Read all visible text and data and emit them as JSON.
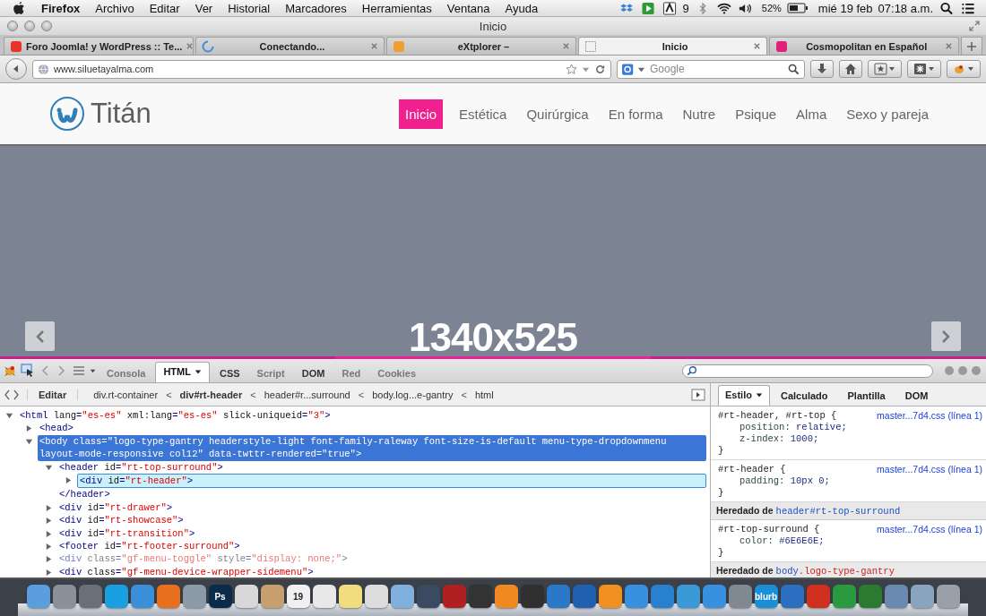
{
  "menubar": {
    "app": "Firefox",
    "items": [
      "Archivo",
      "Editar",
      "Ver",
      "Historial",
      "Marcadores",
      "Herramientas",
      "Ventana",
      "Ayuda"
    ],
    "status": {
      "adobe_count": "9",
      "battery": "52%",
      "date": "mié 19 feb",
      "time": "07:18 a.m."
    }
  },
  "window": {
    "title": "Inicio"
  },
  "tabs": [
    {
      "label": "Foro Joomla! y WordPress :: Te...",
      "selected": false,
      "kind": "site",
      "color": "#e8332b"
    },
    {
      "label": "Conectando...",
      "selected": false,
      "kind": "loading",
      "color": "#3b8de0"
    },
    {
      "label": "eXtplorer –",
      "selected": false,
      "kind": "site",
      "color": "#f0a030"
    },
    {
      "label": "Inicio",
      "selected": true,
      "kind": "blank"
    },
    {
      "label": "Cosmopolitan en Español",
      "selected": false,
      "kind": "site",
      "color": "#e0227a"
    }
  ],
  "navbar": {
    "url": "www.siluetayalma.com",
    "search_placeholder": "Google"
  },
  "site": {
    "logo": "Titán",
    "nav": [
      {
        "label": "Inicio",
        "selected": true
      },
      {
        "label": "Estética",
        "selected": false
      },
      {
        "label": "Quirúrgica",
        "selected": false
      },
      {
        "label": "En forma",
        "selected": false
      },
      {
        "label": "Nutre",
        "selected": false
      },
      {
        "label": "Psique",
        "selected": false
      },
      {
        "label": "Alma",
        "selected": false
      },
      {
        "label": "Sexo y pareja",
        "selected": false
      }
    ]
  },
  "slide": {
    "label": "1340x525"
  },
  "devtools": {
    "tabs": [
      {
        "label": "Consola",
        "selected": false,
        "disabled": true,
        "menu": false
      },
      {
        "label": "HTML",
        "selected": true,
        "disabled": false,
        "menu": true
      },
      {
        "label": "CSS",
        "selected": false,
        "disabled": false,
        "menu": false
      },
      {
        "label": "Script",
        "selected": false,
        "disabled": true,
        "menu": false
      },
      {
        "label": "DOM",
        "selected": false,
        "disabled": false,
        "menu": false
      },
      {
        "label": "Red",
        "selected": false,
        "disabled": true,
        "menu": false
      },
      {
        "label": "Cookies",
        "selected": false,
        "disabled": true,
        "menu": false
      }
    ],
    "edit": "Editar",
    "breadcrumb": [
      {
        "label": "div.rt-container",
        "selected": false
      },
      {
        "label": "div#rt-header",
        "selected": true,
        "separator": "<"
      },
      {
        "label": "header#r...surround",
        "selected": false,
        "separator": "<"
      },
      {
        "label": "body.log...e-gantry",
        "selected": false,
        "separator": "<"
      },
      {
        "label": "html",
        "selected": false,
        "separator": "<"
      }
    ],
    "side_tabs": [
      {
        "label": "Estilo",
        "selected": true,
        "menu": true
      },
      {
        "label": "Calculado",
        "selected": false,
        "menu": false
      },
      {
        "label": "Plantilla",
        "selected": false,
        "menu": false
      },
      {
        "label": "DOM",
        "selected": false,
        "menu": false
      }
    ],
    "tree": [
      {
        "text": "<html lang=\"es-es\" xml:lang=\"es-es\" slick-uniqueid=\"3\">",
        "expanded": true,
        "selected": false,
        "children": [
          {
            "text": "<head>",
            "expanded": false,
            "selected": false
          },
          {
            "text": "<body class=\"logo-type-gantry headerstyle-light font-family-raleway font-size-is-default menu-type-dropdownmenu layout-mode-responsive col12\" data-twttr-rendered=\"true\">",
            "expanded": true,
            "selected": true,
            "children": [
              {
                "text": "<header id=\"rt-top-surround\">",
                "expanded": true,
                "selected": false,
                "closing": "</header>",
                "children": [
                  {
                    "text": "<div id=\"rt-header\">",
                    "expanded": false,
                    "selected": false,
                    "hovered": true
                  }
                ]
              },
              {
                "text": "<div id=\"rt-drawer\">",
                "expanded": false,
                "selected": false
              },
              {
                "text": "<div id=\"rt-showcase\">",
                "expanded": false,
                "selected": false
              },
              {
                "text": "<div id=\"rt-transition\">",
                "expanded": false,
                "selected": false
              },
              {
                "text": "<footer id=\"rt-footer-surround\">",
                "expanded": false,
                "selected": false
              },
              {
                "text": "<div class=\"gf-menu-toggle\" style=\"display: none;\">",
                "expanded": false,
                "selected": false,
                "dimmed": true
              },
              {
                "text": "<div class=\"gf-menu-device-wrapper-sidemenu\">",
                "expanded": false,
                "selected": false
              }
            ]
          }
        ]
      }
    ],
    "styles": [
      {
        "kind": "rule",
        "selector": "#rt-header, #rt-top {",
        "source": "master...7d4.css (línea 1)",
        "props": [
          {
            "name": "position:",
            "value": "relative;"
          },
          {
            "name": "z-index:",
            "value": "1000;"
          }
        ],
        "close": "}"
      },
      {
        "kind": "rule",
        "selector": "#rt-header {",
        "source": "master...7d4.css (línea 1)",
        "props": [
          {
            "name": "padding:",
            "value": "10px 0;"
          }
        ],
        "close": "}"
      },
      {
        "kind": "inherited",
        "label": "Heredado de",
        "target": [
          {
            "text": "header#rt-top-surround",
            "kind": "tag"
          }
        ]
      },
      {
        "kind": "rule",
        "selector": "#rt-top-surround {",
        "source": "master...7d4.css (línea 1)",
        "props": [
          {
            "name": "color:",
            "value": "#6E6E6E;"
          }
        ],
        "close": "}"
      },
      {
        "kind": "inherited",
        "label": "Heredado de",
        "target": [
          {
            "text": "body",
            "kind": "tag"
          },
          {
            "text": ".logo-type-gantry",
            "kind": "class"
          }
        ]
      }
    ]
  },
  "dock": [
    {
      "color": "#5a9ee0"
    },
    {
      "color": "#8a8f99"
    },
    {
      "color": "#6b6f77"
    },
    {
      "color": "#1aa0e0"
    },
    {
      "color": "#3a8fd8"
    },
    {
      "color": "#e8701c"
    },
    {
      "color": "#8c9aa8"
    },
    {
      "color": "#0c2a4a",
      "label": "Ps"
    },
    {
      "color": "#d8d8d8"
    },
    {
      "color": "#c8a070"
    },
    {
      "color": "#f0f0f0",
      "label": "19"
    },
    {
      "color": "#e8e8e8"
    },
    {
      "color": "#f1dd80"
    },
    {
      "color": "#dcdcdc"
    },
    {
      "color": "#7fb0e0"
    },
    {
      "color": "#3a4a60"
    },
    {
      "color": "#b02020"
    },
    {
      "color": "#333333"
    },
    {
      "color": "#f08a20"
    },
    {
      "color": "#303030"
    },
    {
      "color": "#2a78c8"
    },
    {
      "color": "#2060b0"
    },
    {
      "color": "#f09020"
    },
    {
      "color": "#3a90e0"
    },
    {
      "color": "#2a80d0"
    },
    {
      "color": "#3a9ad8"
    },
    {
      "color": "#3a90e0"
    },
    {
      "color": "#808890"
    },
    {
      "color": "#1a8fd6",
      "label": "blurb"
    },
    {
      "color": "#2a6fc0"
    },
    {
      "color": "#d03020"
    },
    {
      "color": "#2a9a40"
    },
    {
      "color": "#2a7a30"
    },
    {
      "color": "#6a8ab0"
    },
    {
      "color": "#8aa4c0"
    },
    {
      "color": "#9aa0a8"
    }
  ]
}
